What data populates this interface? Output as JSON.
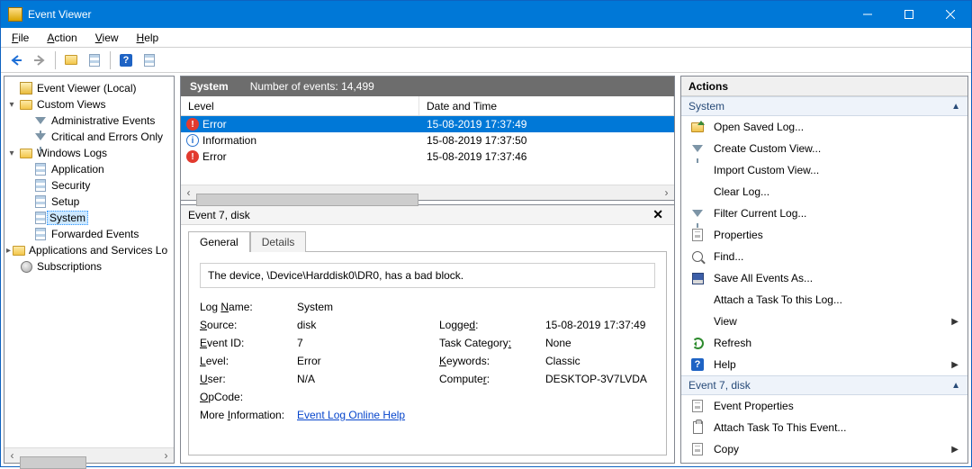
{
  "window": {
    "title": "Event Viewer"
  },
  "menu": {
    "file": "File",
    "action": "Action",
    "view": "View",
    "help": "Help"
  },
  "tree": {
    "root": "Event Viewer (Local)",
    "custom": "Custom Views",
    "admin": "Administrative Events",
    "crit": "Critical and Errors Only",
    "winlogs": "Windows Logs",
    "app": "Application",
    "sec": "Security",
    "setup": "Setup",
    "system": "System",
    "fwd": "Forwarded Events",
    "appserv": "Applications and Services Lo",
    "subs": "Subscriptions"
  },
  "listHeader": {
    "title": "System",
    "count_label": "Number of events: 14,499",
    "col_level": "Level",
    "col_date": "Date and Time"
  },
  "events": [
    {
      "kind": "err",
      "level": "Error",
      "date": "15-08-2019 17:37:49",
      "selected": true
    },
    {
      "kind": "info",
      "level": "Information",
      "date": "15-08-2019 17:37:50",
      "selected": false
    },
    {
      "kind": "err",
      "level": "Error",
      "date": "15-08-2019 17:37:46",
      "selected": false
    }
  ],
  "detail": {
    "title": "Event 7, disk",
    "tab_general": "General",
    "tab_details": "Details",
    "message": "The device, \\Device\\Harddisk0\\DR0, has a bad block.",
    "kv": {
      "logname_k": "Log Name:",
      "logname_v": "System",
      "source_k": "Source:",
      "source_v": "disk",
      "logged_k": "Logged:",
      "logged_v": "15-08-2019 17:37:49",
      "eventid_k": "Event ID:",
      "eventid_v": "7",
      "taskcat_k": "Task Category:",
      "taskcat_v": "None",
      "level_k": "Level:",
      "level_v": "Error",
      "keywords_k": "Keywords:",
      "keywords_v": "Classic",
      "user_k": "User:",
      "user_v": "N/A",
      "computer_k": "Computer:",
      "computer_v": "DESKTOP-3V7LVDA",
      "opcode_k": "OpCode:",
      "moreinfo_k": "More Information:",
      "moreinfo_link": "Event Log Online Help"
    }
  },
  "actions": {
    "title": "Actions",
    "sec1": "System",
    "open": "Open Saved Log...",
    "createView": "Create Custom View...",
    "importView": "Import Custom View...",
    "clear": "Clear Log...",
    "filter": "Filter Current Log...",
    "properties": "Properties",
    "find": "Find...",
    "saveAll": "Save All Events As...",
    "attachLog": "Attach a Task To this Log...",
    "view": "View",
    "refresh": "Refresh",
    "help": "Help",
    "sec2": "Event 7, disk",
    "eventProps": "Event Properties",
    "attachEvent": "Attach Task To This Event...",
    "copy": "Copy"
  }
}
